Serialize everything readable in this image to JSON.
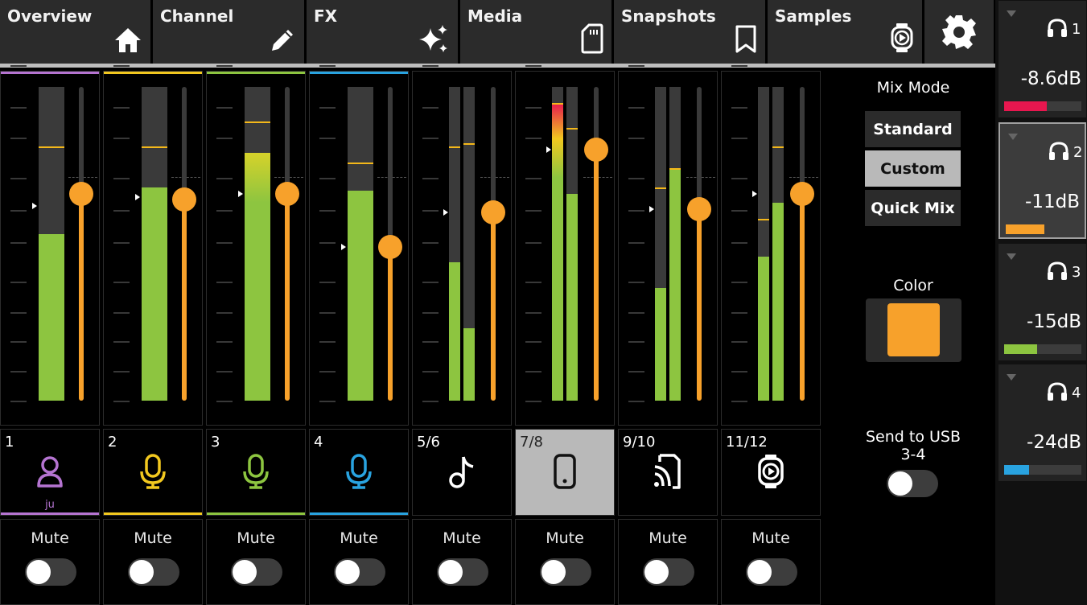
{
  "tabs": [
    {
      "label": "Overview",
      "icon": "home-icon"
    },
    {
      "label": "Channel",
      "icon": "pencil-icon"
    },
    {
      "label": "FX",
      "icon": "sparkles-icon"
    },
    {
      "label": "Media",
      "icon": "sd-card-icon"
    },
    {
      "label": "Snapshots",
      "icon": "bookmark-icon"
    },
    {
      "label": "Samples",
      "icon": "sample-player-icon"
    }
  ],
  "settings_icon": "gear-icon",
  "channels": [
    {
      "number": "1",
      "icon": "user-icon",
      "sublabel": "ju",
      "color": "#b574d1",
      "meter_levels": [
        0.53
      ],
      "peak_levels": [
        0.81
      ],
      "fader_level": 0.66,
      "trim_level": 0.62,
      "mute_label": "Mute",
      "mute_on": false,
      "selected": false
    },
    {
      "number": "2",
      "icon": "microphone-icon",
      "color": "#f2c81f",
      "meter_levels": [
        0.68
      ],
      "peak_levels": [
        0.81
      ],
      "fader_level": 0.64,
      "trim_level": 0.65,
      "mute_label": "Mute",
      "mute_on": false,
      "selected": false
    },
    {
      "number": "3",
      "icon": "microphone-icon",
      "color": "#8dc540",
      "meter_levels": [
        0.79
      ],
      "peak_levels": [
        0.89
      ],
      "fader_level": 0.66,
      "trim_level": 0.66,
      "mute_label": "Mute",
      "mute_on": false,
      "selected": false
    },
    {
      "number": "4",
      "icon": "microphone-icon",
      "color": "#29a3e0",
      "meter_levels": [
        0.67
      ],
      "peak_levels": [
        0.76
      ],
      "fader_level": 0.49,
      "trim_level": 0.49,
      "mute_label": "Mute",
      "mute_on": false,
      "selected": false
    },
    {
      "number": "5/6",
      "icon": "music-note-icon",
      "color": "#2c2c2c",
      "meter_levels": [
        0.44,
        0.23
      ],
      "peak_levels": [
        0.81,
        0.82
      ],
      "fader_level": 0.6,
      "trim_level": 0.6,
      "mute_label": "Mute",
      "mute_on": false,
      "selected": false
    },
    {
      "number": "7/8",
      "icon": "phone-icon",
      "color": "#2c2c2c",
      "meter_levels": [
        0.95,
        0.66
      ],
      "peak_levels": [
        0.95,
        0.87
      ],
      "fader_level": 0.8,
      "trim_level": 0.8,
      "mute_label": "Mute",
      "mute_on": false,
      "selected": true
    },
    {
      "number": "9/10",
      "icon": "cast-icon",
      "color": "#2c2c2c",
      "meter_levels": [
        0.36,
        0.74
      ],
      "peak_levels": [
        0.68,
        0.74
      ],
      "fader_level": 0.61,
      "trim_level": 0.61,
      "mute_label": "Mute",
      "mute_on": false,
      "selected": false
    },
    {
      "number": "11/12",
      "icon": "sample-player-icon",
      "color": "#2c2c2c",
      "meter_levels": [
        0.46,
        0.63
      ],
      "peak_levels": [
        0.58,
        0.81
      ],
      "fader_level": 0.66,
      "trim_level": 0.66,
      "mute_label": "Mute",
      "mute_on": false,
      "selected": false
    }
  ],
  "mix_mode": {
    "title": "Mix Mode",
    "options": [
      "Standard",
      "Custom",
      "Quick Mix"
    ],
    "selected": "Custom"
  },
  "color": {
    "label": "Color",
    "value": "#f7a12b"
  },
  "send_usb": {
    "label": "Send to USB 3-4",
    "on": false
  },
  "mixes": [
    {
      "number": "1",
      "level": "-8.6dB",
      "fill": 0.55,
      "color": "#e8174f",
      "selected": false
    },
    {
      "number": "2",
      "level": "-11dB",
      "fill": 0.5,
      "color": "#f7a12b",
      "selected": true
    },
    {
      "number": "3",
      "level": "-15dB",
      "fill": 0.43,
      "color": "#8dc540",
      "selected": false
    },
    {
      "number": "4",
      "level": "-24dB",
      "fill": 0.32,
      "color": "#29a3e0",
      "selected": false
    }
  ]
}
